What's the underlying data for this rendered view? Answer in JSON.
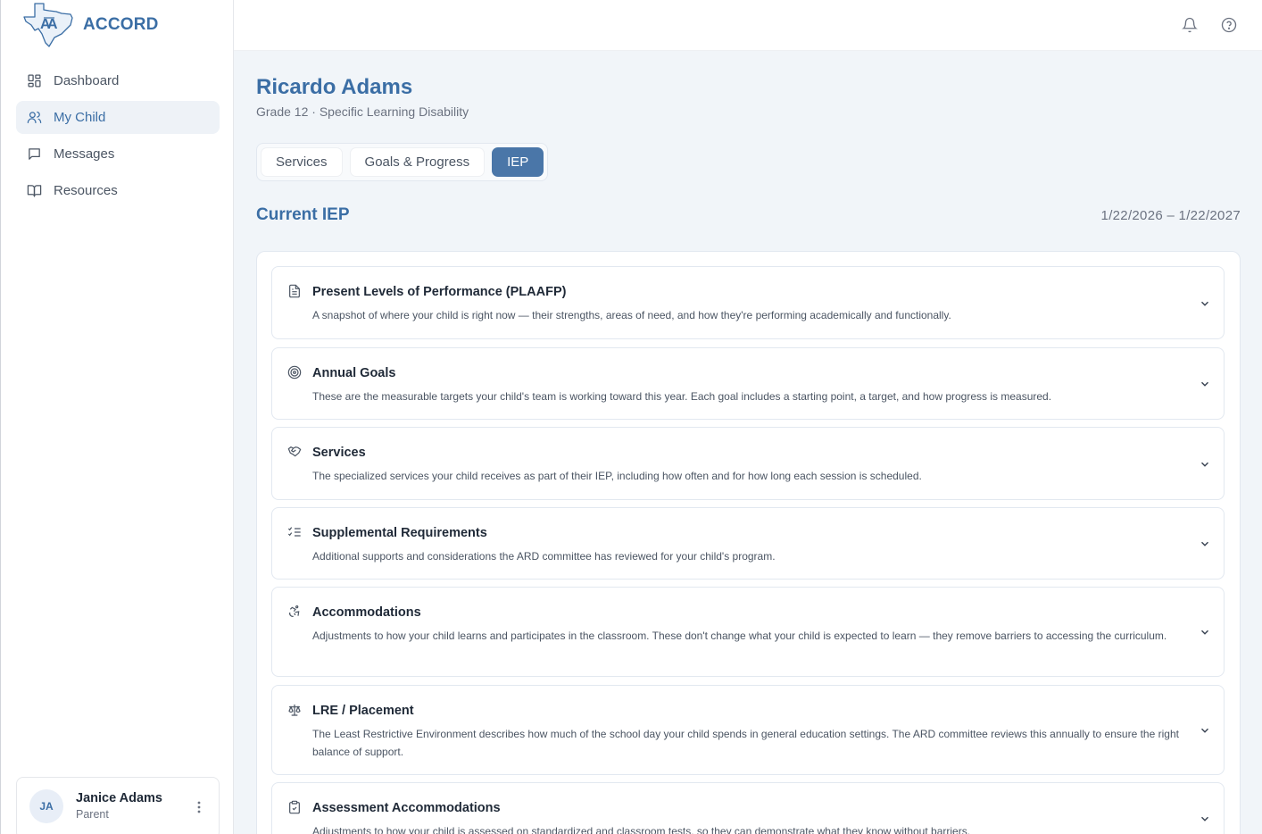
{
  "brand": {
    "name": "ACCORD"
  },
  "sidebar": {
    "items": [
      {
        "label": "Dashboard",
        "icon": "dashboard-icon",
        "active": false
      },
      {
        "label": "My Child",
        "icon": "users-icon",
        "active": true
      },
      {
        "label": "Messages",
        "icon": "message-icon",
        "active": false
      },
      {
        "label": "Resources",
        "icon": "book-icon",
        "active": false
      }
    ]
  },
  "user": {
    "initials": "JA",
    "name": "Janice Adams",
    "role": "Parent"
  },
  "topbar": {
    "icons": [
      "bell-icon",
      "help-icon"
    ]
  },
  "student": {
    "name": "Ricardo Adams",
    "subtitle": "Grade 12 · Specific Learning Disability"
  },
  "tabs": [
    {
      "label": "Services",
      "active": false
    },
    {
      "label": "Goals & Progress",
      "active": false
    },
    {
      "label": "IEP",
      "active": true
    }
  ],
  "iep": {
    "title": "Current IEP",
    "date_range": "1/22/2026 – 1/22/2027",
    "sections": [
      {
        "title": "Present Levels of Performance (PLAAFP)",
        "icon": "document-icon",
        "description": "A snapshot of where your child is right now — their strengths, areas of need, and how they're performing academically and functionally."
      },
      {
        "title": "Annual Goals",
        "icon": "target-icon",
        "description": "These are the measurable targets your child's team is working toward this year. Each goal includes a starting point, a target, and how progress is measured."
      },
      {
        "title": "Services",
        "icon": "handshake-icon",
        "description": "The specialized services your child receives as part of their IEP, including how often and for how long each session is scheduled."
      },
      {
        "title": "Supplemental Requirements",
        "icon": "checklist-icon",
        "description": "Additional supports and considerations the ARD committee has reviewed for your child's program."
      },
      {
        "title": "Accommodations",
        "icon": "accessibility-icon",
        "description": "Adjustments to how your child learns and participates in the classroom. These don't change what your child is expected to learn — they remove barriers to accessing the curriculum."
      },
      {
        "title": "LRE / Placement",
        "icon": "scale-icon",
        "description": "The Least Restrictive Environment describes how much of the school day your child spends in general education settings. The ARD committee reviews this annually to ensure the right balance of support."
      },
      {
        "title": "Assessment Accommodations",
        "icon": "clipboard-check-icon",
        "description": "Adjustments to how your child is assessed on standardized and classroom tests, so they can demonstrate what they know without barriers."
      }
    ]
  },
  "colors": {
    "accent": "#3b6ea5",
    "tab_active": "#4a76a8",
    "background": "#f1f5f9"
  }
}
